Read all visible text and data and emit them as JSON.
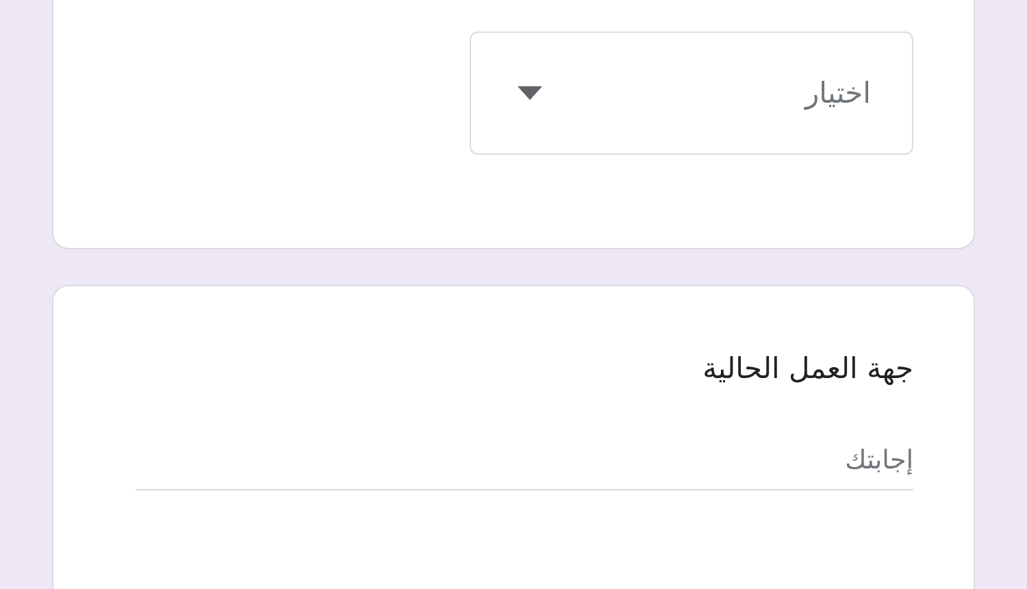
{
  "choice_question": {
    "dropdown": {
      "placeholder": "اختيار"
    }
  },
  "text_question": {
    "title": "جهة العمل الحالية",
    "answer": {
      "placeholder": "إجابتك"
    }
  }
}
